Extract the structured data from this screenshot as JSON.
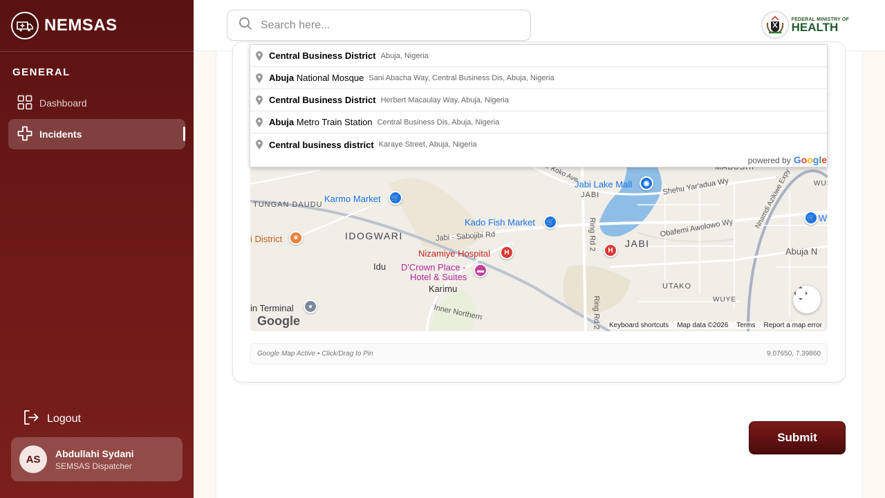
{
  "brand": {
    "name": "NEMSAS"
  },
  "sidebar": {
    "section_label": "GENERAL",
    "items": [
      {
        "label": "Dashboard",
        "icon": "grid-icon",
        "active": false
      },
      {
        "label": "Incidents",
        "icon": "medical-cross-icon",
        "active": true
      }
    ],
    "logout_label": "Logout",
    "user": {
      "initials": "AS",
      "name": "Abdullahi Sydani",
      "role": "SEMSAS Dispatcher"
    }
  },
  "header": {
    "search": {
      "placeholder": "Search here...",
      "value": ""
    },
    "ministry": {
      "line1": "FEDERAL MINISTRY OF",
      "line2": "HEALTH"
    }
  },
  "autocomplete": {
    "suggestions": [
      {
        "match": "Central Business District",
        "rest": "",
        "secondary": "Abuja, Nigeria"
      },
      {
        "match": "Abuja",
        "rest": " National Mosque",
        "secondary": "Sani Abacha Way, Central Business Dis, Abuja, Nigeria"
      },
      {
        "match": "Central Business District",
        "rest": "",
        "secondary": "Herbert Macaulay Way, Abuja, Nigeria"
      },
      {
        "match": "Abuja",
        "rest": " Metro Train Station",
        "secondary": "Central Business Dis, Abuja, Nigeria"
      },
      {
        "match": "Central business district",
        "rest": "",
        "secondary": "Karaye Street, Abuja, Nigeria"
      }
    ],
    "powered_by": "powered by",
    "powered_brand": "Google"
  },
  "map": {
    "labels": {
      "karmo_market": "Karmo Market",
      "tungan_daudu": "TUNGAN DAUDU",
      "idogwari": "IDOGWARI",
      "district": "i District",
      "idu": "Idu",
      "kado_fish_market": "Kado Fish Market",
      "jabi_sabojibi": "Jabi - Sabojibi Rd",
      "nizamiye_hospital": "Nizamiye Hospital",
      "dcrown_place": "D'Crown Place -",
      "dcrown_place_2": "Hotel & Suites",
      "karimu": "Karimu",
      "terminal": "in Terminal",
      "inner_northern": "Inner Northern",
      "jabi_lake_mall": "Jabi Lake Mall",
      "jabi_small": "JABI",
      "jabi_big": "JABI",
      "ring_rd_2a": "Ring Rd 2",
      "ring_rd_2b": "Ring Rd 2",
      "ukar_koko": "ukar Koko Ave",
      "shehu_yaradua": "Shehu Yar'adua Wy",
      "obafemi": "Obafemi Awolowo Wy",
      "nnamdi": "Nnamdi Azikiwe Expy",
      "utako": "UTAKO",
      "wuye": "WUYE",
      "abuja_n": "Abuja N",
      "mabushi": "MABUSHI",
      "wus": "WUS",
      "w": "W"
    },
    "logo": "Google",
    "attribution": [
      "Keyboard shortcuts",
      "Map data ©2026",
      "Terms",
      "Report a map error"
    ]
  },
  "map_status": {
    "hint": "Google Map Active • Click/Drag to Pin",
    "coords": "9.07650, 7.39860"
  },
  "submit_label": "Submit",
  "colors": {
    "brand_dark": "#5a1212",
    "brand_mid": "#7a1f1c",
    "ministry_green": "#1f5a2c",
    "poi_blue": "#1a73e8",
    "poi_red": "#c5221f"
  }
}
